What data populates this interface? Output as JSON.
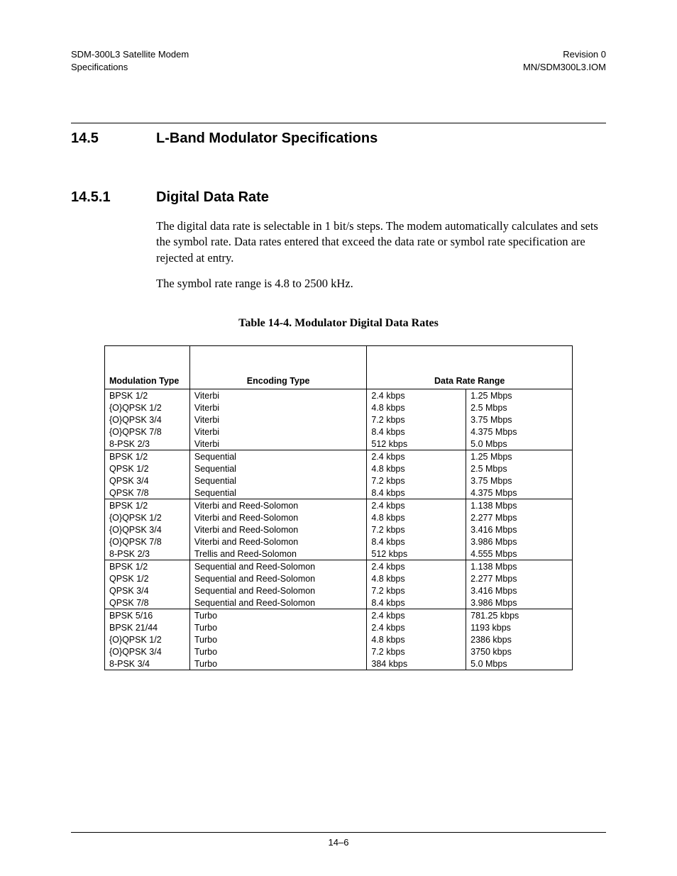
{
  "header": {
    "left_line1": "SDM-300L3 Satellite Modem",
    "left_line2": "Specifications",
    "right_line1": "Revision 0",
    "right_line2": "MN/SDM300L3.IOM"
  },
  "section": {
    "number": "14.5",
    "title": "L-Band Modulator Specifications"
  },
  "subsection": {
    "number": "14.5.1",
    "title": "Digital Data Rate"
  },
  "paragraphs": {
    "p1": "The digital data rate is selectable in 1 bit/s steps. The modem automatically calculates and sets the symbol rate. Data rates entered that exceed the data rate or symbol rate specification are rejected at entry.",
    "p2": "The symbol rate range is 4.8 to 2500 kHz."
  },
  "table": {
    "caption": "Table 14-4.  Modulator Digital Data Rates",
    "headers": {
      "mod": "Modulation Type",
      "enc": "Encoding Type",
      "range": "Data Rate Range"
    },
    "groups": [
      {
        "rows": [
          {
            "mod": "BPSK 1/2",
            "enc": "Viterbi",
            "min": "2.4 kbps",
            "max": "1.25 Mbps"
          },
          {
            "mod": "{O}QPSK 1/2",
            "enc": "Viterbi",
            "min": "4.8 kbps",
            "max": "2.5 Mbps"
          },
          {
            "mod": "{O}QPSK 3/4",
            "enc": "Viterbi",
            "min": "7.2 kbps",
            "max": "3.75 Mbps"
          },
          {
            "mod": "{O}QPSK 7/8",
            "enc": "Viterbi",
            "min": "8.4 kbps",
            "max": "4.375 Mbps"
          },
          {
            "mod": "8-PSK 2/3",
            "enc": "Viterbi",
            "min": "512 kbps",
            "max": "5.0 Mbps"
          }
        ]
      },
      {
        "rows": [
          {
            "mod": "BPSK 1/2",
            "enc": "Sequential",
            "min": "2.4 kbps",
            "max": "1.25 Mbps"
          },
          {
            "mod": "QPSK 1/2",
            "enc": "Sequential",
            "min": "4.8 kbps",
            "max": "2.5 Mbps"
          },
          {
            "mod": "QPSK 3/4",
            "enc": "Sequential",
            "min": "7.2 kbps",
            "max": "3.75 Mbps"
          },
          {
            "mod": "QPSK 7/8",
            "enc": "Sequential",
            "min": "8.4 kbps",
            "max": "4.375 Mbps"
          }
        ]
      },
      {
        "rows": [
          {
            "mod": "BPSK 1/2",
            "enc": "Viterbi and Reed-Solomon",
            "min": "2.4 kbps",
            "max": "1.138 Mbps"
          },
          {
            "mod": "{O}QPSK 1/2",
            "enc": "Viterbi and Reed-Solomon",
            "min": "4.8 kbps",
            "max": "2.277 Mbps"
          },
          {
            "mod": "{O}QPSK 3/4",
            "enc": "Viterbi and Reed-Solomon",
            "min": "7.2 kbps",
            "max": "3.416 Mbps"
          },
          {
            "mod": "{O}QPSK 7/8",
            "enc": "Viterbi and Reed-Solomon",
            "min": "8.4 kbps",
            "max": "3.986 Mbps"
          },
          {
            "mod": "8-PSK 2/3",
            "enc": "Trellis and Reed-Solomon",
            "min": "512 kbps",
            "max": "4.555 Mbps"
          }
        ]
      },
      {
        "rows": [
          {
            "mod": "BPSK 1/2",
            "enc": "Sequential and Reed-Solomon",
            "min": "2.4 kbps",
            "max": "1.138 Mbps"
          },
          {
            "mod": "QPSK 1/2",
            "enc": "Sequential and Reed-Solomon",
            "min": "4.8 kbps",
            "max": "2.277 Mbps"
          },
          {
            "mod": "QPSK 3/4",
            "enc": "Sequential and Reed-Solomon",
            "min": "7.2 kbps",
            "max": "3.416 Mbps"
          },
          {
            "mod": "QPSK 7/8",
            "enc": "Sequential and Reed-Solomon",
            "min": "8.4 kbps",
            "max": "3.986 Mbps"
          }
        ]
      },
      {
        "rows": [
          {
            "mod": "BPSK 5/16",
            "enc": "Turbo",
            "min": "2.4 kbps",
            "max": "781.25 kbps"
          },
          {
            "mod": "BPSK 21/44",
            "enc": "Turbo",
            "min": "2.4 kbps",
            "max": "1193 kbps"
          },
          {
            "mod": "{O}QPSK 1/2",
            "enc": "Turbo",
            "min": "4.8 kbps",
            "max": "2386 kbps"
          },
          {
            "mod": "{O}QPSK 3/4",
            "enc": "Turbo",
            "min": "7.2 kbps",
            "max": "3750 kbps"
          },
          {
            "mod": "8-PSK 3/4",
            "enc": "Turbo",
            "min": "384 kbps",
            "max": "5.0 Mbps"
          }
        ]
      }
    ]
  },
  "footer": {
    "page": "14–6"
  }
}
